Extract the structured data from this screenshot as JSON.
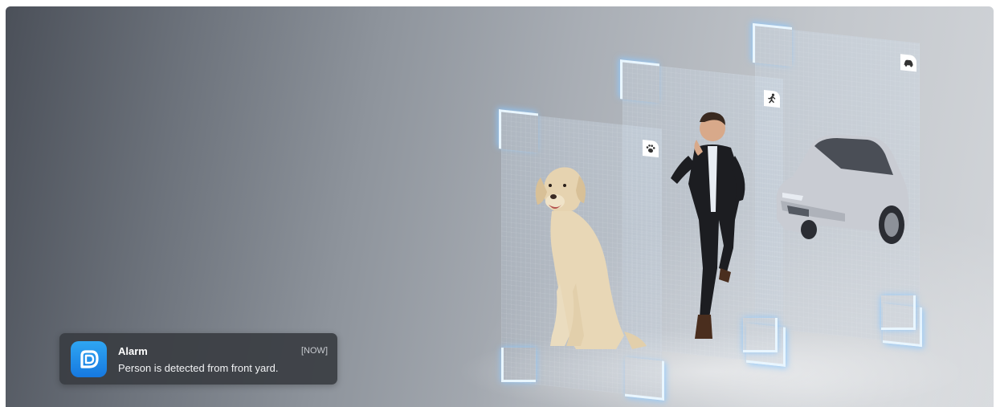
{
  "notification": {
    "title": "Alarm",
    "time": "[NOW]",
    "message": "Person is detected from front yard.",
    "app_icon": "app-logo-icon"
  },
  "detection_panels": [
    {
      "subject": "dog",
      "tag_icon": "paw-icon"
    },
    {
      "subject": "person",
      "tag_icon": "running-person-icon"
    },
    {
      "subject": "car",
      "tag_icon": "car-icon"
    }
  ],
  "colors": {
    "toast_bg": "#3a3d42",
    "app_icon": "#1f8ce8",
    "frame_glow": "#e9f6ff"
  }
}
